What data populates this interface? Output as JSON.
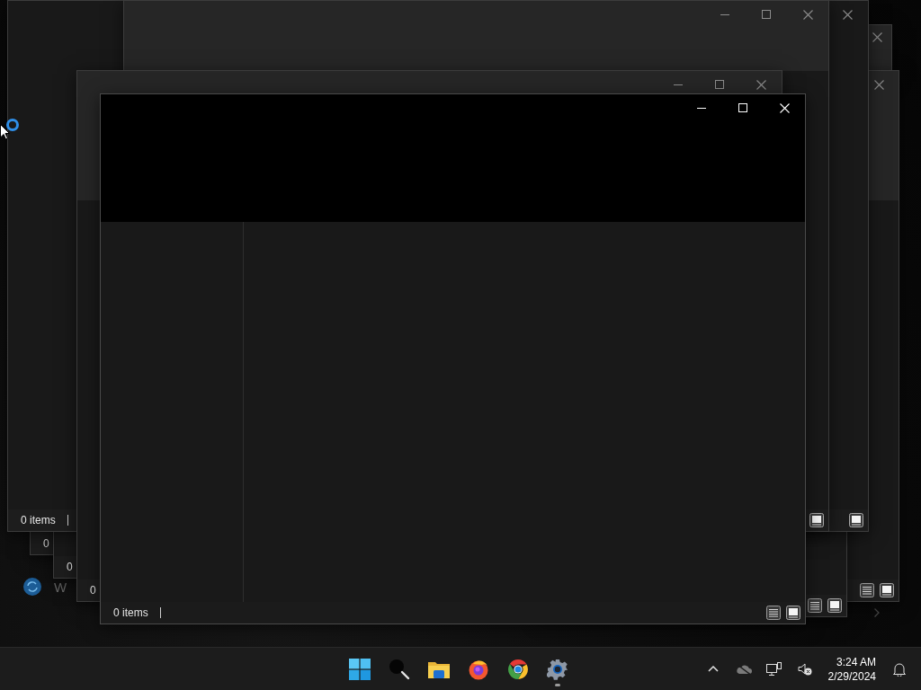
{
  "windows": [
    {
      "kind": "frame"
    },
    {
      "kind": "frame"
    },
    {
      "kind": "frame"
    },
    {
      "kind": "frame",
      "status": "0"
    },
    {
      "kind": "frame",
      "status": "0"
    },
    {
      "kind": "frame",
      "status": "0 items"
    },
    {
      "kind": "frame"
    },
    {
      "kind": "frame",
      "status": "0"
    },
    {
      "kind": "front",
      "status": "0 items"
    }
  ],
  "desktop_items": [
    {
      "label": "W"
    }
  ],
  "taskbar": {
    "apps": [
      {
        "kind": "start",
        "running": false
      },
      {
        "kind": "search",
        "running": false
      },
      {
        "kind": "files",
        "running": false
      },
      {
        "kind": "fox_browser",
        "running": false
      },
      {
        "kind": "round_browser",
        "running": false
      },
      {
        "kind": "settings",
        "running": true
      }
    ],
    "tray": {
      "time": "3:24 AM",
      "date": "2/29/2024"
    }
  }
}
